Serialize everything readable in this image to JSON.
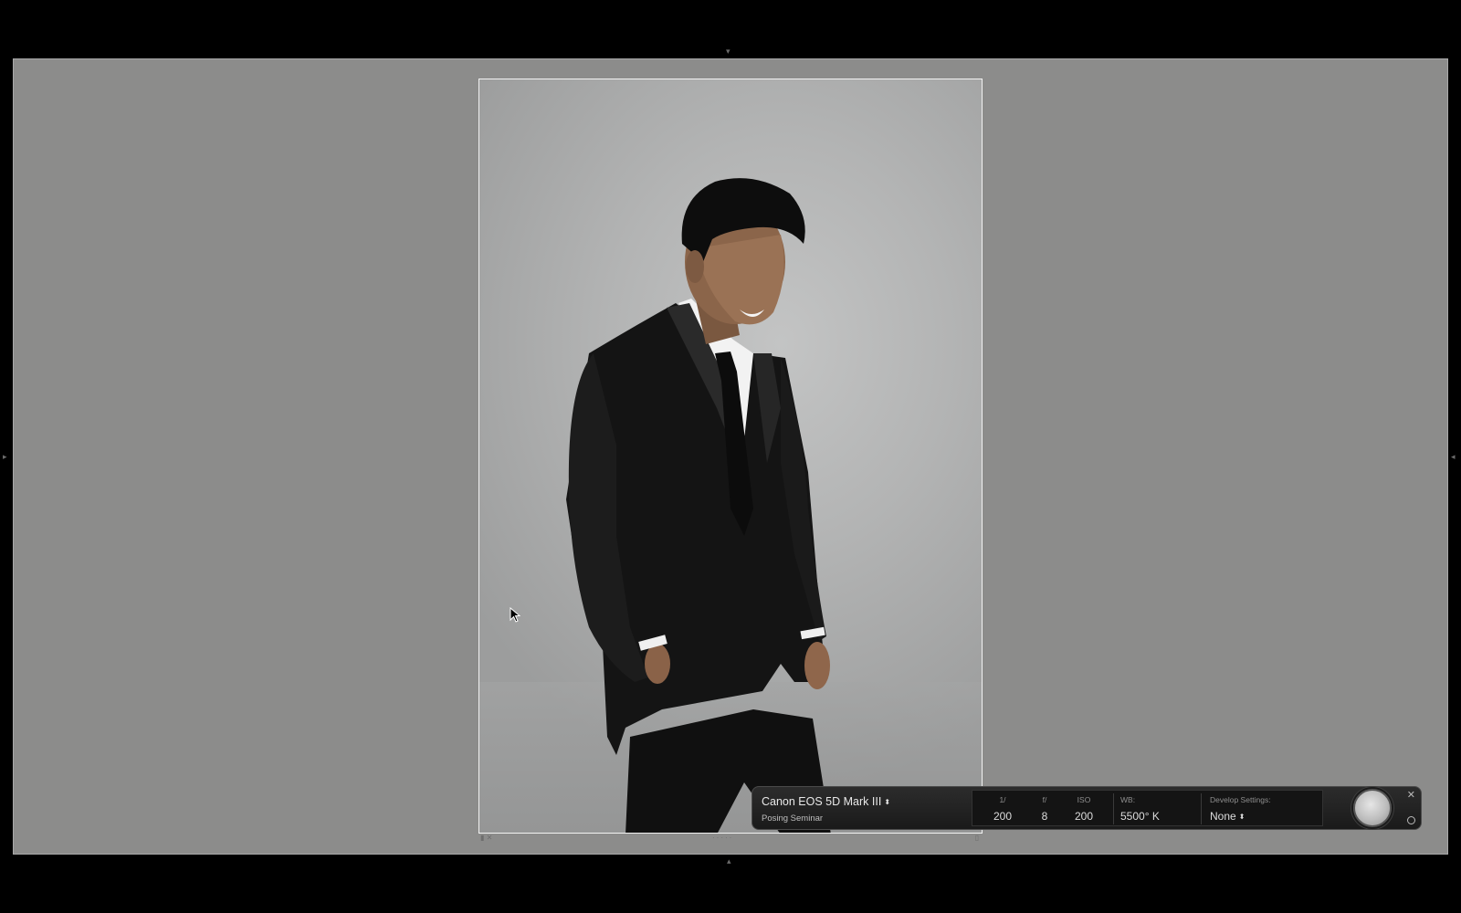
{
  "window": {
    "background_color": "#000000",
    "canvas_color": "#8c8c8b"
  },
  "panel_arrows": {
    "top": "triangle-down-icon",
    "bottom": "triangle-up-icon",
    "left": "triangle-right-icon",
    "right": "triangle-left-icon"
  },
  "photo": {
    "subject": "man-in-black-suit-photo",
    "background_color": "#b5b6b6"
  },
  "tether_bar": {
    "camera_name": "Canon EOS 5D Mark III",
    "session_name": "Posing Seminar",
    "shutter": {
      "label": "1/",
      "value": "200"
    },
    "aperture": {
      "label": "f/",
      "value": "8"
    },
    "iso": {
      "label": "ISO",
      "value": "200"
    },
    "white_balance": {
      "label": "WB:",
      "value": "5500° K"
    },
    "develop_settings": {
      "label": "Develop Settings:",
      "value": "None"
    },
    "caret_glyph": "⬍",
    "close_glyph": "✕"
  }
}
